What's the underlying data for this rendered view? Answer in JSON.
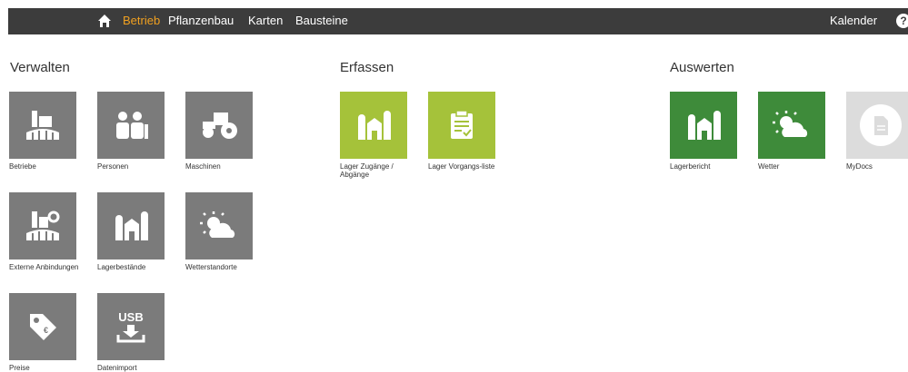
{
  "nav": {
    "home_icon": "home-icon",
    "items": [
      {
        "label": "Betrieb",
        "active": true
      },
      {
        "label": "Pflanzenbau",
        "active": false
      },
      {
        "label": "Karten",
        "active": false
      },
      {
        "label": "Bausteine",
        "active": false
      }
    ],
    "kalender": "Kalender",
    "help": "?"
  },
  "sections": {
    "verwalten": {
      "title": "Verwalten",
      "tiles": [
        {
          "label": "Betriebe",
          "icon": "farm-buildings-icon",
          "color": "#7b7b7b"
        },
        {
          "label": "Personen",
          "icon": "persons-icon",
          "color": "#7b7b7b"
        },
        {
          "label": "Maschinen",
          "icon": "tractor-icon",
          "color": "#7b7b7b"
        },
        {
          "label": "Externe Anbindungen",
          "icon": "farm-gear-icon",
          "color": "#7b7b7b"
        },
        {
          "label": "Lagerbestände",
          "icon": "silo-icon",
          "color": "#7b7b7b"
        },
        {
          "label": "Wetterstandorte",
          "icon": "weather-icon",
          "color": "#7b7b7b"
        },
        {
          "label": "Preise",
          "icon": "price-tag-icon",
          "color": "#7b7b7b"
        },
        {
          "label": "Datenimport",
          "icon": "usb-import-icon",
          "color": "#7b7b7b"
        }
      ]
    },
    "erfassen": {
      "title": "Erfassen",
      "tiles": [
        {
          "label": "Lager Zugänge / Abgänge",
          "icon": "silo-icon",
          "color": "#a5c23a"
        },
        {
          "label": "Lager Vorgangs-liste",
          "icon": "clipboard-icon",
          "color": "#a5c23a"
        }
      ]
    },
    "auswerten": {
      "title": "Auswerten",
      "tiles": [
        {
          "label": "Lagerbericht",
          "icon": "silo-icon",
          "color": "#3e8b3a"
        },
        {
          "label": "Wetter",
          "icon": "weather-icon",
          "color": "#3e8b3a"
        },
        {
          "label": "MyDocs",
          "icon": "document-icon",
          "color": "#dcdcdc"
        }
      ]
    }
  }
}
